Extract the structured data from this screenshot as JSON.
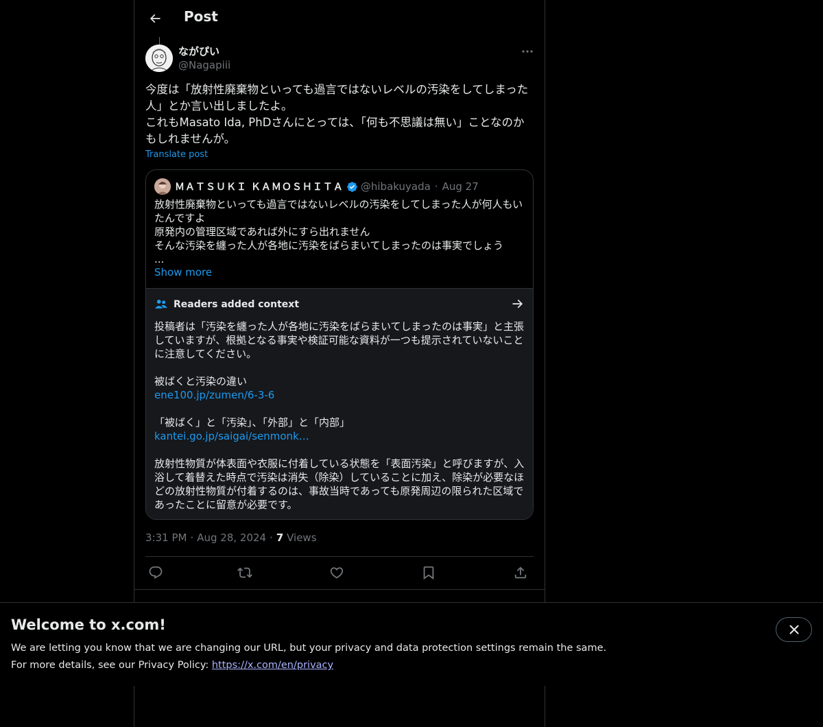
{
  "header": {
    "title": "Post",
    "back_icon": "arrow-left-icon"
  },
  "post": {
    "author_name": "ながぴい",
    "author_handle": "@Nagapiii",
    "text": "今度は「放射性廃棄物といっても過言ではないレベルの汚染をしてしまった人」とか言い出しましたよ。\nこれもMasato Ida, PhDさんにとっては、「何も不思議は無い」ことなのかもしれませんが。",
    "translate_label": "Translate post",
    "time": "3:31 PM",
    "date": "Aug 28, 2024",
    "views_count": "7",
    "views_label": "Views"
  },
  "quote": {
    "author_name": "ＭＡＴＳＵＫＩ ＫＡＭＯＳＨＩＴＡ",
    "handle": "@hibakuyada",
    "date": "Aug 27",
    "text": "放射性廃棄物といっても過言ではないレベルの汚染をしてしまった人が何人もいたんですよ\n原発内の管理区域であれば外にすら出れません\nそんな汚染を纏った人が各地に汚染をばらまいてしまったのは事実でしょう\n...",
    "show_more": "Show more"
  },
  "context": {
    "title": "Readers added context",
    "para1": "投稿者は「汚染を纏った人が各地に汚染をばらまいてしまったのは事実」と主張していますが、根拠となる事実や検証可能な資料が一つも提示されていないことに注意してください。",
    "para2": "被ばくと汚染の違い",
    "link1": "ene100.jp/zumen/6-3-6",
    "para3": "「被ばく」と「汚染」、「外部」と「内部」",
    "link2": "kantei.go.jp/saigai/senmonk…",
    "para4": "放射性物質が体表面や衣服に付着している状態を「表面汚染」と呼びますが、入浴して着替えた時点で汚染は消失（除染）していることに加え、除染が必要なほどの放射性物質が付着するのは、事故当時であっても原発周辺の限られた区域であったことに留意が必要です。"
  },
  "banner": {
    "title": "Welcome to x.com!",
    "line1": "We are letting you know that we are changing our URL, but your privacy and data protection settings remain the same.",
    "line2_prefix": "For more details, see our Privacy Policy:",
    "link": "https://x.com/en/privacy"
  },
  "colors": {
    "accent": "#1d9bf0",
    "background": "#000000",
    "border": "#2f3336",
    "muted": "#71767b"
  }
}
